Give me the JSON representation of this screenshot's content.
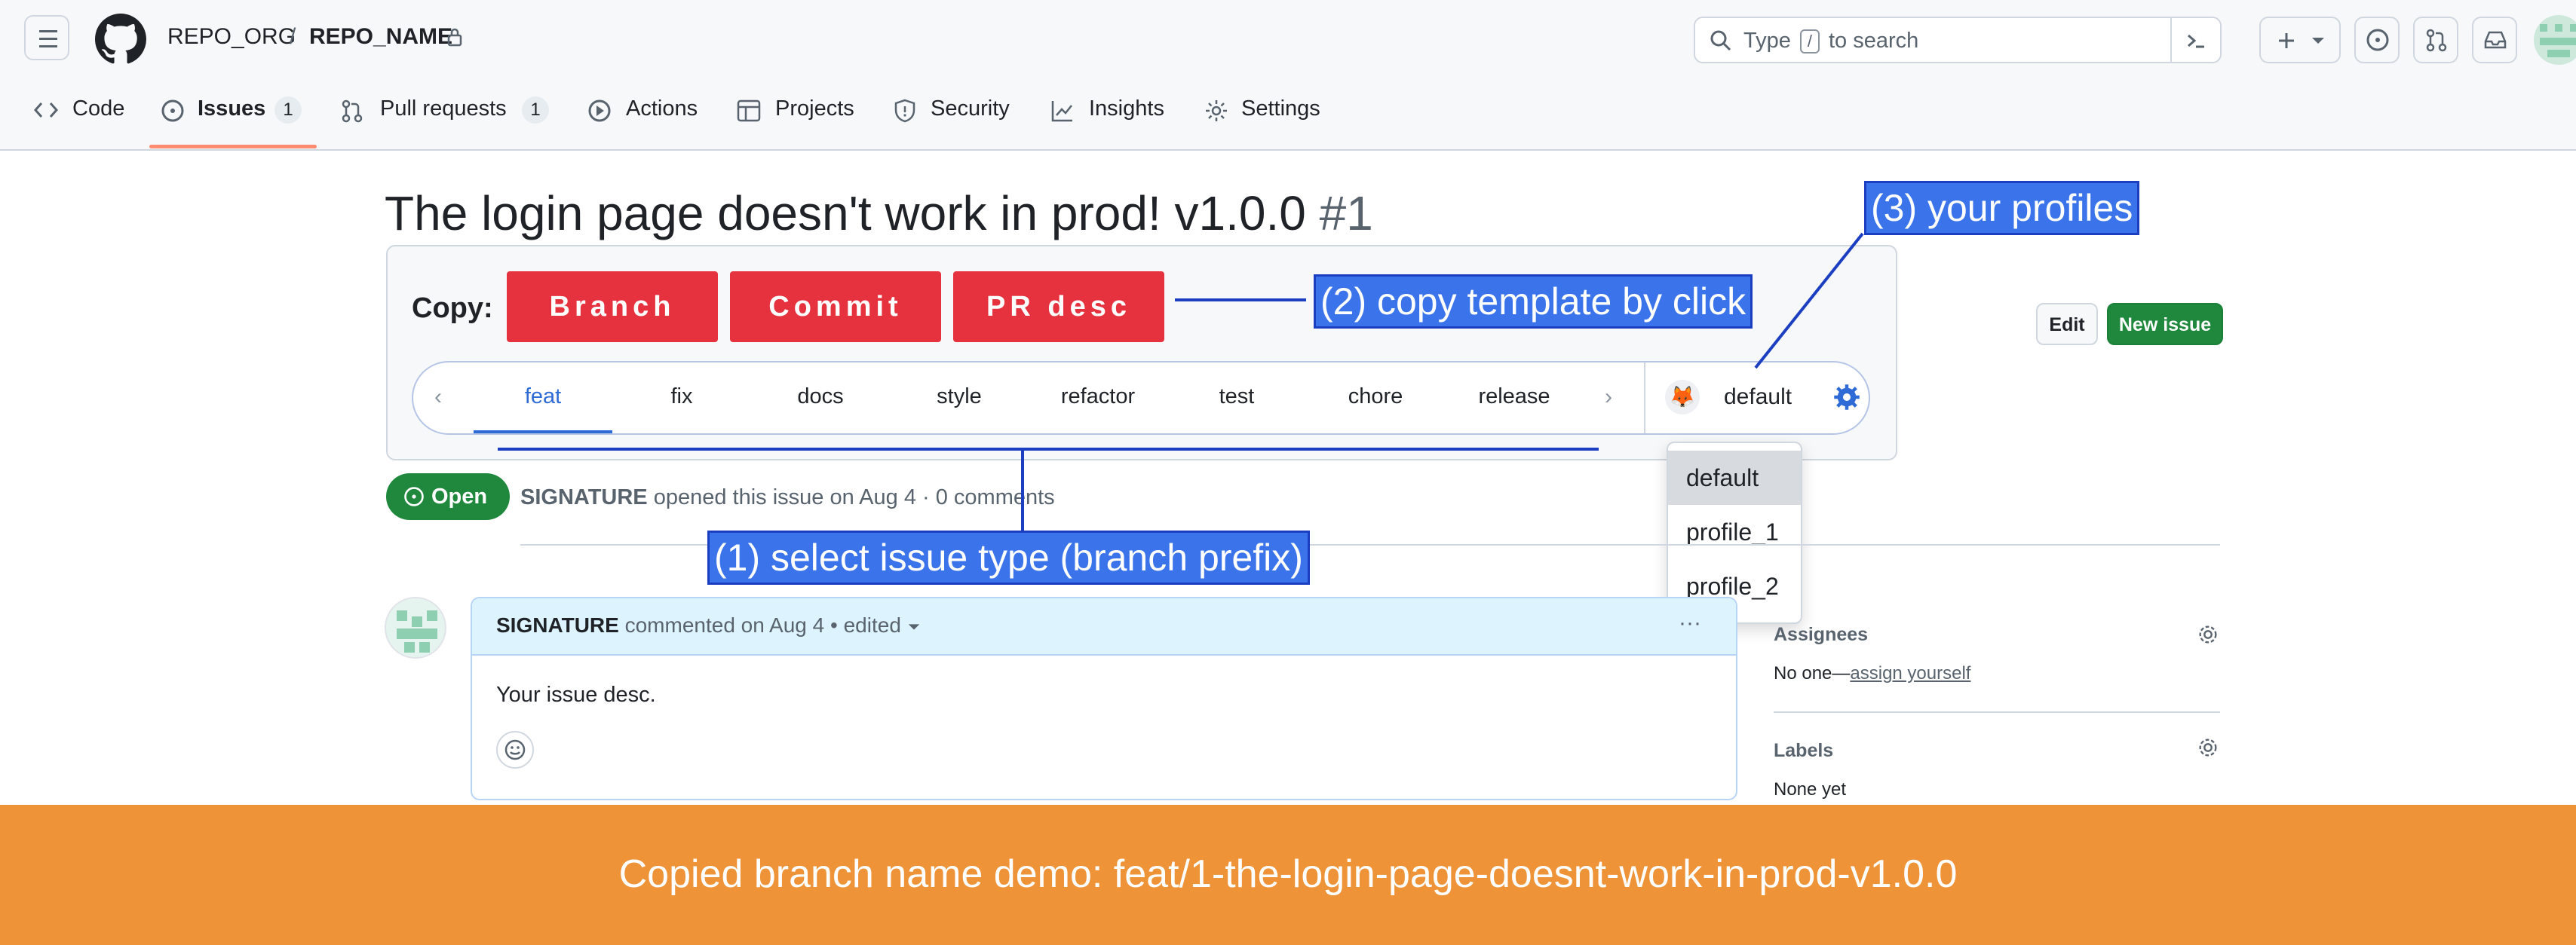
{
  "header": {
    "org": "REPO_ORG",
    "sep": "/",
    "repo": "REPO_NAME",
    "search_before": "Type",
    "search_key": "/",
    "search_after": "to search"
  },
  "nav": {
    "tabs": [
      {
        "label": "Code",
        "icon": "code-icon"
      },
      {
        "label": "Issues",
        "icon": "issue-opened-icon",
        "count": "1"
      },
      {
        "label": "Pull requests",
        "icon": "git-pull-request-icon",
        "count": "1"
      },
      {
        "label": "Actions",
        "icon": "play-icon"
      },
      {
        "label": "Projects",
        "icon": "table-icon"
      },
      {
        "label": "Security",
        "icon": "shield-icon"
      },
      {
        "label": "Insights",
        "icon": "graph-icon"
      },
      {
        "label": "Settings",
        "icon": "gear-icon"
      }
    ],
    "active_tab": "Issues"
  },
  "issue": {
    "title": "The login page doesn't work in prod! v1.0.0",
    "number": "#1",
    "state": "Open",
    "author": "SIGNATURE",
    "opened_text": "opened this issue on Aug 4 · 0 comments"
  },
  "extension": {
    "copy_label": "Copy:",
    "buttons": [
      "Branch",
      "Commit",
      "PR desc"
    ],
    "types": [
      "feat",
      "fix",
      "docs",
      "style",
      "refactor",
      "test",
      "chore",
      "release"
    ],
    "active_type": "feat",
    "profile_current": "default",
    "profiles": [
      "default",
      "profile_1",
      "profile_2"
    ],
    "accent": "#e5323e"
  },
  "annotations": {
    "select_type": "(1) select issue type (branch prefix)",
    "copy_template": "(2) copy template by click",
    "profiles": "(3) your profiles"
  },
  "actions": {
    "edit": "Edit",
    "new_issue": "New issue"
  },
  "comment": {
    "author": "SIGNATURE",
    "meta": "commented on Aug 4",
    "edited": "• edited",
    "body": "Your issue desc."
  },
  "sidebar": {
    "assignees_label": "Assignees",
    "assignees_value_prefix": "No one—",
    "assignees_link": "assign yourself",
    "labels_label": "Labels",
    "labels_value": "None yet"
  },
  "banner": {
    "text": "Copied branch name demo: feat/1-the-login-page-doesnt-work-in-prod-v1.0.0",
    "color": "#ee9337"
  }
}
